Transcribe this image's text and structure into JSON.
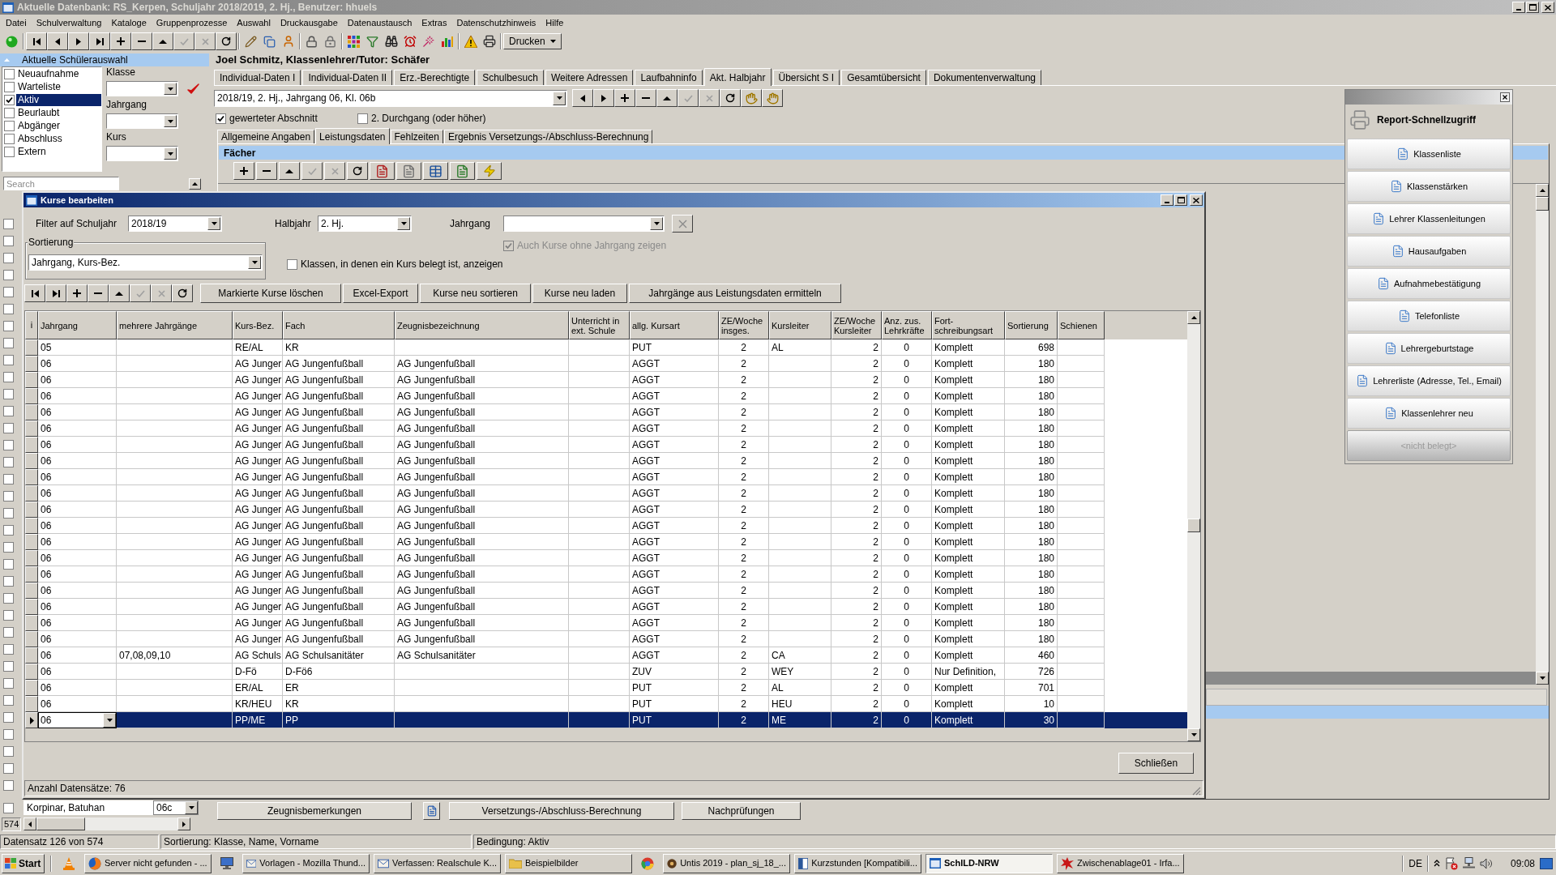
{
  "window": {
    "title": "Aktuelle Datenbank: RS_Kerpen, Schuljahr 2018/2019, 2. Hj., Benutzer: hhuels"
  },
  "menu": [
    "Datei",
    "Schulverwaltung",
    "Kataloge",
    "Gruppenprozesse",
    "Auswahl",
    "Druckausgabe",
    "Datenaustausch",
    "Extras",
    "Datenschutzhinweis",
    "Hilfe"
  ],
  "toolbar": {
    "groups": [
      [
        {
          "kind": "status",
          "disabled": false
        }
      ],
      [
        {
          "kind": "first",
          "disabled": false
        },
        {
          "kind": "previous",
          "disabled": false
        },
        {
          "kind": "next",
          "disabled": false
        },
        {
          "kind": "last",
          "disabled": false
        },
        {
          "kind": "add",
          "disabled": false
        },
        {
          "kind": "remove",
          "disabled": false
        },
        {
          "kind": "up",
          "disabled": false
        },
        {
          "kind": "confirm",
          "disabled": true
        },
        {
          "kind": "cancel",
          "disabled": true
        },
        {
          "kind": "refresh",
          "disabled": false
        }
      ],
      [
        {
          "kind": "edit",
          "disabled": false
        },
        {
          "kind": "copy",
          "disabled": false
        },
        {
          "kind": "person",
          "disabled": false
        }
      ],
      [
        {
          "kind": "lock",
          "disabled": false
        },
        {
          "kind": "userlock",
          "disabled": false
        }
      ],
      [
        {
          "kind": "grid",
          "disabled": false
        },
        {
          "kind": "filter",
          "disabled": false
        },
        {
          "kind": "search",
          "disabled": false
        },
        {
          "kind": "alarm",
          "disabled": false
        },
        {
          "kind": "wand",
          "disabled": false
        },
        {
          "kind": "chart",
          "disabled": false
        }
      ],
      [
        {
          "kind": "warning",
          "disabled": false
        },
        {
          "kind": "print",
          "disabled": false
        }
      ]
    ],
    "print_menu": "Drucken"
  },
  "student_selection": {
    "title": "Aktuelle Schülerauswahl",
    "statuses": [
      {
        "label": "Neuaufnahme",
        "checked": false,
        "selected": false
      },
      {
        "label": "Warteliste",
        "checked": false,
        "selected": false
      },
      {
        "label": "Aktiv",
        "checked": true,
        "selected": true
      },
      {
        "label": "Beurlaubt",
        "checked": false,
        "selected": false
      },
      {
        "label": "Abgänger",
        "checked": false,
        "selected": false
      },
      {
        "label": "Abschluss",
        "checked": false,
        "selected": false
      },
      {
        "label": "Extern",
        "checked": false,
        "selected": false
      }
    ],
    "fields": [
      {
        "label": "Klasse"
      },
      {
        "label": "Jahrgang"
      },
      {
        "label": "Kurs"
      }
    ]
  },
  "student_grid": {
    "search": {
      "placeholder": "Search"
    },
    "rows": [
      {
        "checked": false
      },
      {
        "checked": false
      },
      {
        "checked": false
      },
      {
        "checked": false
      },
      {
        "checked": false
      },
      {
        "checked": false
      },
      {
        "checked": false
      },
      {
        "checked": false
      },
      {
        "checked": false
      },
      {
        "checked": false
      },
      {
        "checked": false
      },
      {
        "checked": false
      },
      {
        "checked": false
      },
      {
        "checked": false
      },
      {
        "checked": false
      },
      {
        "checked": false
      },
      {
        "checked": false
      },
      {
        "checked": false
      },
      {
        "checked": false
      },
      {
        "checked": false
      },
      {
        "checked": false
      },
      {
        "checked": false
      },
      {
        "checked": false
      },
      {
        "checked": false
      },
      {
        "checked": false
      },
      {
        "checked": false
      },
      {
        "checked": false
      },
      {
        "checked": false
      },
      {
        "checked": false
      },
      {
        "checked": false
      },
      {
        "checked": false
      },
      {
        "checked": false
      },
      {
        "checked": false
      },
      {
        "checked": false
      },
      {
        "checked": false,
        "name": "Korpinar, Batuhan",
        "class": "06c"
      }
    ],
    "count": "574"
  },
  "student": {
    "heading": "Joel Schmitz, Klassenlehrer/Tutor: Schäfer"
  },
  "tabs": [
    {
      "label": "Individual-Daten I",
      "selected": false
    },
    {
      "label": "Individual-Daten II",
      "selected": false
    },
    {
      "label": "Erz.-Berechtigte",
      "selected": false
    },
    {
      "label": "Schulbesuch",
      "selected": false
    },
    {
      "label": "Weitere Adressen",
      "selected": false
    },
    {
      "label": "Laufbahninfo",
      "selected": false
    },
    {
      "label": "Akt. Halbjahr",
      "selected": true
    },
    {
      "label": "Übersicht S I",
      "selected": false
    },
    {
      "label": "Gesamtübersicht",
      "selected": false
    },
    {
      "label": "Dokumentenverwaltung",
      "selected": false
    }
  ],
  "section": {
    "value": "2018/19, 2. Hj., Jahrgang 06, Kl. 06b",
    "nav": [
      {
        "kind": "previous",
        "disabled": false
      },
      {
        "kind": "next",
        "disabled": false
      },
      {
        "kind": "add",
        "disabled": false
      },
      {
        "kind": "remove",
        "disabled": false
      },
      {
        "kind": "up",
        "disabled": false
      },
      {
        "kind": "confirm",
        "disabled": true
      },
      {
        "kind": "cancel",
        "disabled": true
      },
      {
        "kind": "refresh",
        "disabled": false
      },
      {
        "kind": "pointleft",
        "disabled": false
      },
      {
        "kind": "pointright",
        "disabled": false
      }
    ]
  },
  "options": [
    {
      "label": "gewerteter Abschnitt",
      "checked": true
    },
    {
      "label": "2. Durchgang (oder höher)",
      "checked": false
    }
  ],
  "subtabs": [
    {
      "label": "Allgemeine Angaben",
      "selected": false
    },
    {
      "label": "Leistungsdaten",
      "selected": true
    },
    {
      "label": "Fehlzeiten",
      "selected": false
    },
    {
      "label": "Ergebnis Versetzungs-/Abschluss-Berechnung",
      "selected": false
    }
  ],
  "subjects": {
    "title": "Fächer",
    "toolbar": [
      {
        "kind": "add",
        "disabled": false
      },
      {
        "kind": "remove",
        "disabled": false
      },
      {
        "kind": "up",
        "disabled": false
      },
      {
        "kind": "confirm",
        "disabled": true
      },
      {
        "kind": "cancel",
        "disabled": true
      },
      {
        "kind": "refresh",
        "disabled": false
      },
      {
        "kind": "report",
        "disabled": false
      },
      {
        "kind": "document",
        "disabled": false
      },
      {
        "kind": "table",
        "disabled": false
      },
      {
        "kind": "export",
        "disabled": false
      },
      {
        "kind": "zap",
        "disabled": false
      }
    ]
  },
  "bottom_actions": [
    {
      "kind": "text",
      "label": "Zeugnisbemerkungen"
    },
    {
      "kind": "icon"
    },
    {
      "kind": "text",
      "label": "Versetzungs-/Abschluss-Berechnung"
    },
    {
      "kind": "text",
      "label": "Nachprüfungen"
    }
  ],
  "report_panel": {
    "title": "Report-Schnellzugriff",
    "items": [
      {
        "label": "Klassenliste",
        "disabled": false
      },
      {
        "label": "Klassenstärken",
        "disabled": false
      },
      {
        "label": "Lehrer Klassenleitungen",
        "disabled": false
      },
      {
        "label": "Hausaufgaben",
        "disabled": false
      },
      {
        "label": "Aufnahmebestätigung",
        "disabled": false
      },
      {
        "label": "Telefonliste",
        "disabled": false
      },
      {
        "label": "Lehrergeburtstage",
        "disabled": false
      },
      {
        "label": "Lehrerliste (Adresse, Tel., Email)",
        "disabled": false
      },
      {
        "label": "Klassenlehrer neu",
        "disabled": false
      },
      {
        "label": "<nicht belegt>",
        "disabled": true
      }
    ]
  },
  "dialog": {
    "title": "Kurse bearbeiten",
    "filters": [
      {
        "label": "Filter auf Schuljahr",
        "value": "2018/19"
      },
      {
        "label": "Halbjahr",
        "value": "2. Hj."
      },
      {
        "label": "Jahrgang"
      }
    ],
    "clear_filter": {
      "disabled": true
    },
    "show_without_grade": {
      "label": "Auch Kurse ohne Jahrgang zeigen",
      "checked": true,
      "disabled": true
    },
    "sorting": {
      "label": "Sortierung",
      "value": "Jahrgang, Kurs-Bez."
    },
    "show_classes": {
      "label": "Klassen, in denen ein Kurs belegt ist, anzeigen",
      "checked": false
    },
    "nav": [
      {
        "kind": "first",
        "disabled": false
      },
      {
        "kind": "last",
        "disabled": false
      },
      {
        "kind": "add",
        "disabled": false
      },
      {
        "kind": "remove",
        "disabled": false
      },
      {
        "kind": "up",
        "disabled": false
      },
      {
        "kind": "confirm",
        "disabled": true
      },
      {
        "kind": "cancel",
        "disabled": true
      },
      {
        "kind": "refresh",
        "disabled": false
      }
    ],
    "actions": [
      "Markierte Kurse löschen",
      "Excel-Export",
      "Kurse neu sortieren",
      "Kurse neu laden",
      "Jahrgänge aus Leistungsdaten ermitteln"
    ],
    "table": {
      "row_header_label": "i",
      "columns": [
        "Jahrgang",
        "mehrere Jahrgänge",
        "Kurs-Bez.",
        "Fach",
        "Zeugnisbezeichnung",
        "Unterricht in ext. Schule",
        "allg. Kursart",
        "ZE/Woche insges.",
        "Kursleiter",
        "ZE/Woche Kursleiter",
        "Anz. zus. Lehrkräfte",
        "Fort-schreibungsart",
        "Sortierung",
        "Schienen"
      ],
      "rows": [
        {
          "selected": false,
          "cells": [
            "05",
            null,
            "RE/AL",
            "KR",
            null,
            null,
            "PUT",
            "2",
            "AL",
            "2",
            "0",
            "Komplett",
            "698",
            null
          ]
        },
        {
          "selected": false,
          "cells": [
            "06",
            null,
            "AG Junger",
            "AG Jungenfußball",
            "AG Jungenfußball",
            null,
            "AGGT",
            "2",
            null,
            "2",
            "0",
            "Komplett",
            "180",
            null
          ]
        },
        {
          "selected": false,
          "cells": [
            "06",
            null,
            "AG Junger",
            "AG Jungenfußball",
            "AG Jungenfußball",
            null,
            "AGGT",
            "2",
            null,
            "2",
            "0",
            "Komplett",
            "180",
            null
          ]
        },
        {
          "selected": false,
          "cells": [
            "06",
            null,
            "AG Junger",
            "AG Jungenfußball",
            "AG Jungenfußball",
            null,
            "AGGT",
            "2",
            null,
            "2",
            "0",
            "Komplett",
            "180",
            null
          ]
        },
        {
          "selected": false,
          "cells": [
            "06",
            null,
            "AG Junger",
            "AG Jungenfußball",
            "AG Jungenfußball",
            null,
            "AGGT",
            "2",
            null,
            "2",
            "0",
            "Komplett",
            "180",
            null
          ]
        },
        {
          "selected": false,
          "cells": [
            "06",
            null,
            "AG Junger",
            "AG Jungenfußball",
            "AG Jungenfußball",
            null,
            "AGGT",
            "2",
            null,
            "2",
            "0",
            "Komplett",
            "180",
            null
          ]
        },
        {
          "selected": false,
          "cells": [
            "06",
            null,
            "AG Junger",
            "AG Jungenfußball",
            "AG Jungenfußball",
            null,
            "AGGT",
            "2",
            null,
            "2",
            "0",
            "Komplett",
            "180",
            null
          ]
        },
        {
          "selected": false,
          "cells": [
            "06",
            null,
            "AG Junger",
            "AG Jungenfußball",
            "AG Jungenfußball",
            null,
            "AGGT",
            "2",
            null,
            "2",
            "0",
            "Komplett",
            "180",
            null
          ]
        },
        {
          "selected": false,
          "cells": [
            "06",
            null,
            "AG Junger",
            "AG Jungenfußball",
            "AG Jungenfußball",
            null,
            "AGGT",
            "2",
            null,
            "2",
            "0",
            "Komplett",
            "180",
            null
          ]
        },
        {
          "selected": false,
          "cells": [
            "06",
            null,
            "AG Junger",
            "AG Jungenfußball",
            "AG Jungenfußball",
            null,
            "AGGT",
            "2",
            null,
            "2",
            "0",
            "Komplett",
            "180",
            null
          ]
        },
        {
          "selected": false,
          "cells": [
            "06",
            null,
            "AG Junger",
            "AG Jungenfußball",
            "AG Jungenfußball",
            null,
            "AGGT",
            "2",
            null,
            "2",
            "0",
            "Komplett",
            "180",
            null
          ]
        },
        {
          "selected": false,
          "cells": [
            "06",
            null,
            "AG Junger",
            "AG Jungenfußball",
            "AG Jungenfußball",
            null,
            "AGGT",
            "2",
            null,
            "2",
            "0",
            "Komplett",
            "180",
            null
          ]
        },
        {
          "selected": false,
          "cells": [
            "06",
            null,
            "AG Junger",
            "AG Jungenfußball",
            "AG Jungenfußball",
            null,
            "AGGT",
            "2",
            null,
            "2",
            "0",
            "Komplett",
            "180",
            null
          ]
        },
        {
          "selected": false,
          "cells": [
            "06",
            null,
            "AG Junger",
            "AG Jungenfußball",
            "AG Jungenfußball",
            null,
            "AGGT",
            "2",
            null,
            "2",
            "0",
            "Komplett",
            "180",
            null
          ]
        },
        {
          "selected": false,
          "cells": [
            "06",
            null,
            "AG Junger",
            "AG Jungenfußball",
            "AG Jungenfußball",
            null,
            "AGGT",
            "2",
            null,
            "2",
            "0",
            "Komplett",
            "180",
            null
          ]
        },
        {
          "selected": false,
          "cells": [
            "06",
            null,
            "AG Junger",
            "AG Jungenfußball",
            "AG Jungenfußball",
            null,
            "AGGT",
            "2",
            null,
            "2",
            "0",
            "Komplett",
            "180",
            null
          ]
        },
        {
          "selected": false,
          "cells": [
            "06",
            null,
            "AG Junger",
            "AG Jungenfußball",
            "AG Jungenfußball",
            null,
            "AGGT",
            "2",
            null,
            "2",
            "0",
            "Komplett",
            "180",
            null
          ]
        },
        {
          "selected": false,
          "cells": [
            "06",
            null,
            "AG Junger",
            "AG Jungenfußball",
            "AG Jungenfußball",
            null,
            "AGGT",
            "2",
            null,
            "2",
            "0",
            "Komplett",
            "180",
            null
          ]
        },
        {
          "selected": false,
          "cells": [
            "06",
            null,
            "AG Junger",
            "AG Jungenfußball",
            "AG Jungenfußball",
            null,
            "AGGT",
            "2",
            null,
            "2",
            "0",
            "Komplett",
            "180",
            null
          ]
        },
        {
          "selected": false,
          "cells": [
            "06",
            "07,08,09,10",
            "AG Schuls",
            "AG Schulsanitäter",
            "AG Schulsanitäter",
            null,
            "AGGT",
            "2",
            "CA",
            "2",
            "0",
            "Komplett",
            "460",
            null
          ]
        },
        {
          "selected": false,
          "cells": [
            "06",
            null,
            "D-Fö",
            "D-Fö6",
            null,
            null,
            "ZUV",
            "2",
            "WEY",
            "2",
            "0",
            "Nur Definition,",
            "726",
            null
          ]
        },
        {
          "selected": false,
          "cells": [
            "06",
            null,
            "ER/AL",
            "ER",
            null,
            null,
            "PUT",
            "2",
            "AL",
            "2",
            "0",
            "Komplett",
            "701",
            null
          ]
        },
        {
          "selected": false,
          "cells": [
            "06",
            null,
            "KR/HEU",
            "KR",
            null,
            null,
            "PUT",
            "2",
            "HEU",
            "2",
            "0",
            "Komplett",
            "10",
            null
          ]
        },
        {
          "selected": true,
          "cells": [
            "06",
            null,
            "PP/ME",
            "PP",
            null,
            null,
            "PUT",
            "2",
            "ME",
            "2",
            "0",
            "Komplett",
            "30",
            null
          ]
        }
      ]
    },
    "close_button": "Schließen",
    "record_count": "Anzahl Datensätze: 76"
  },
  "status_bar": [
    "Datensatz 126 von 574",
    "Sortierung: Klasse, Name, Vorname",
    "Bedingung: Aktiv"
  ],
  "taskbar": {
    "start": "Start",
    "items": [
      {
        "kind": "launcher"
      },
      {
        "kind": "task",
        "label": "Server nicht gefunden - ...",
        "selected": false
      },
      {
        "kind": "launcher"
      },
      {
        "kind": "task",
        "label": "Vorlagen - Mozilla Thund...",
        "selected": false
      },
      {
        "kind": "task",
        "label": "Verfassen: Realschule K...",
        "selected": false
      },
      {
        "kind": "task",
        "label": "Beispielbilder",
        "selected": false
      },
      {
        "kind": "launcher"
      },
      {
        "kind": "task",
        "label": "Untis 2019 - plan_sj_18_...",
        "selected": false
      },
      {
        "kind": "task",
        "label": "Kurzstunden [Kompatibili...",
        "selected": false
      },
      {
        "kind": "task",
        "label": "SchILD-NRW",
        "selected": true
      },
      {
        "kind": "task",
        "label": "Zwischenablage01 - Irfa...",
        "selected": false
      }
    ],
    "language": "DE",
    "clock": "09:08"
  }
}
